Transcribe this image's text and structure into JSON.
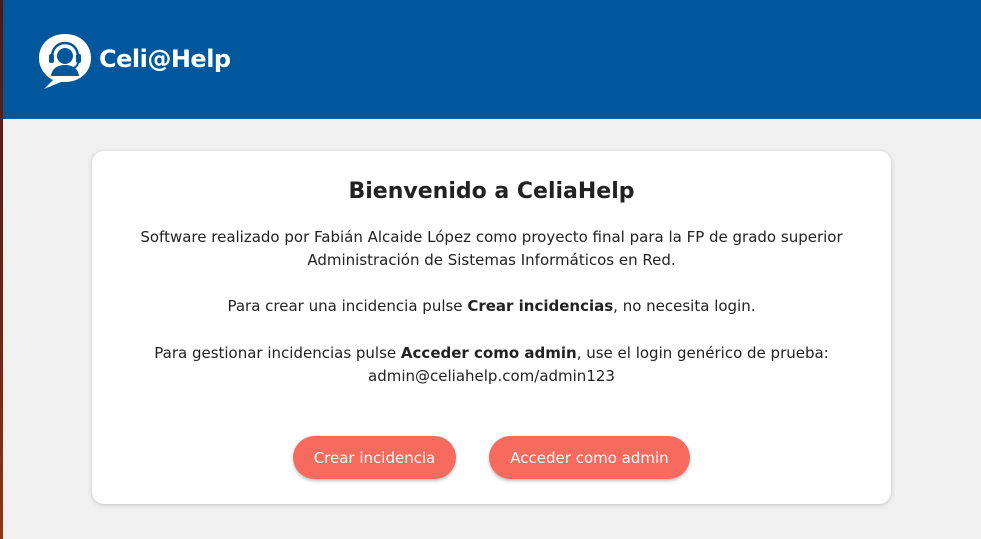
{
  "header": {
    "brand": "Celi@Help",
    "background_color": "#01579b",
    "logo_icon": "headset-chat-bubble-icon"
  },
  "welcome": {
    "title": "Bienvenido a CeliaHelp",
    "intro_line1": "Software realizado por Fabián Alcaide López como proyecto final para la FP de grado superior",
    "intro_line2": "Administración de Sistemas Informáticos en Red.",
    "create_prefix": "Para crear una incidencia pulse ",
    "create_bold": "Crear incidencias",
    "create_suffix": ", no necesita login.",
    "admin_prefix": "Para gestionar incidencias pulse ",
    "admin_bold": "Acceder como admin",
    "admin_suffix": ", use el login genérico de prueba:",
    "credentials": "admin@celiahelp.com/admin123"
  },
  "actions": {
    "create_label": "Crear incidencia",
    "admin_label": "Acceder como admin",
    "button_color": "#f66b5e"
  }
}
